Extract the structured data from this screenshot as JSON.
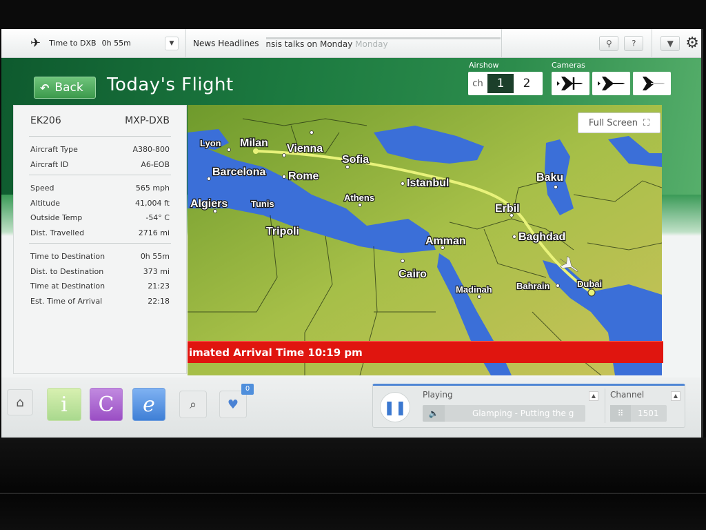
{
  "topbar": {
    "time_to_label": "Time to DXB",
    "time_to_value": "0h 55m",
    "news_label": "News Headlines",
    "news_ticker": "nsis talks on Monday",
    "news_ticker_ghost": "Monday",
    "icons": [
      "plane-icon",
      "dropdown-icon",
      "seat-icon",
      "help-icon",
      "settings-icon"
    ],
    "help_label": "?"
  },
  "header": {
    "back_label": "Back",
    "title": "Today's Flight",
    "airshow_label": "Airshow",
    "channel_prefix": "ch",
    "channel_options": [
      "1",
      "2"
    ],
    "active_channel": "1",
    "cameras_label": "Cameras"
  },
  "flight": {
    "number": "EK206",
    "route": "MXP-DXB",
    "aircraft": [
      {
        "label": "Aircraft Type",
        "value": "A380-800"
      },
      {
        "label": "Aircraft ID",
        "value": "A6-EOB"
      }
    ],
    "status": [
      {
        "label": "Speed",
        "value": "565 mph"
      },
      {
        "label": "Altitude",
        "value": "41,004 ft"
      },
      {
        "label": "Outside Temp",
        "value": "-54° C"
      },
      {
        "label": "Dist. Travelled",
        "value": "2716 mi"
      }
    ],
    "destination": [
      {
        "label": "Time to Destination",
        "value": "0h 55m"
      },
      {
        "label": "Dist. to Destination",
        "value": "373 mi"
      },
      {
        "label": "Time at Destination",
        "value": "21:23"
      },
      {
        "label": "Est. Time of Arrival",
        "value": "22:18"
      }
    ]
  },
  "map": {
    "fullscreen_label": "Full Screen",
    "eta_banner": "imated Arrival Time 10:19 pm",
    "cities": [
      "Lyon",
      "Milan",
      "Vienna",
      "Sofia",
      "Barcelona",
      "Rome",
      "Istanbul",
      "Baku",
      "Algiers",
      "Tunis",
      "Athens",
      "Erbil",
      "Tripoli",
      "Amman",
      "Baghdad",
      "Cairo",
      "Madinah",
      "Bahrain",
      "Dubai"
    ],
    "colors": {
      "sea": "#3b6fd8",
      "land": "#9dbb3c",
      "route": "#e8f27a",
      "banner": "#e0150f"
    }
  },
  "dock": {
    "icons": [
      "home-icon",
      "info-icon",
      "c-icon",
      "e-icon",
      "search-icon",
      "heart-icon"
    ],
    "info_letter": "i",
    "c_letter": "C",
    "e_letter": "e",
    "fav_count": "0"
  },
  "player": {
    "playing_label": "Playing",
    "track": "Glamping - Putting the g",
    "channel_label": "Channel",
    "channel_value": "1501"
  }
}
